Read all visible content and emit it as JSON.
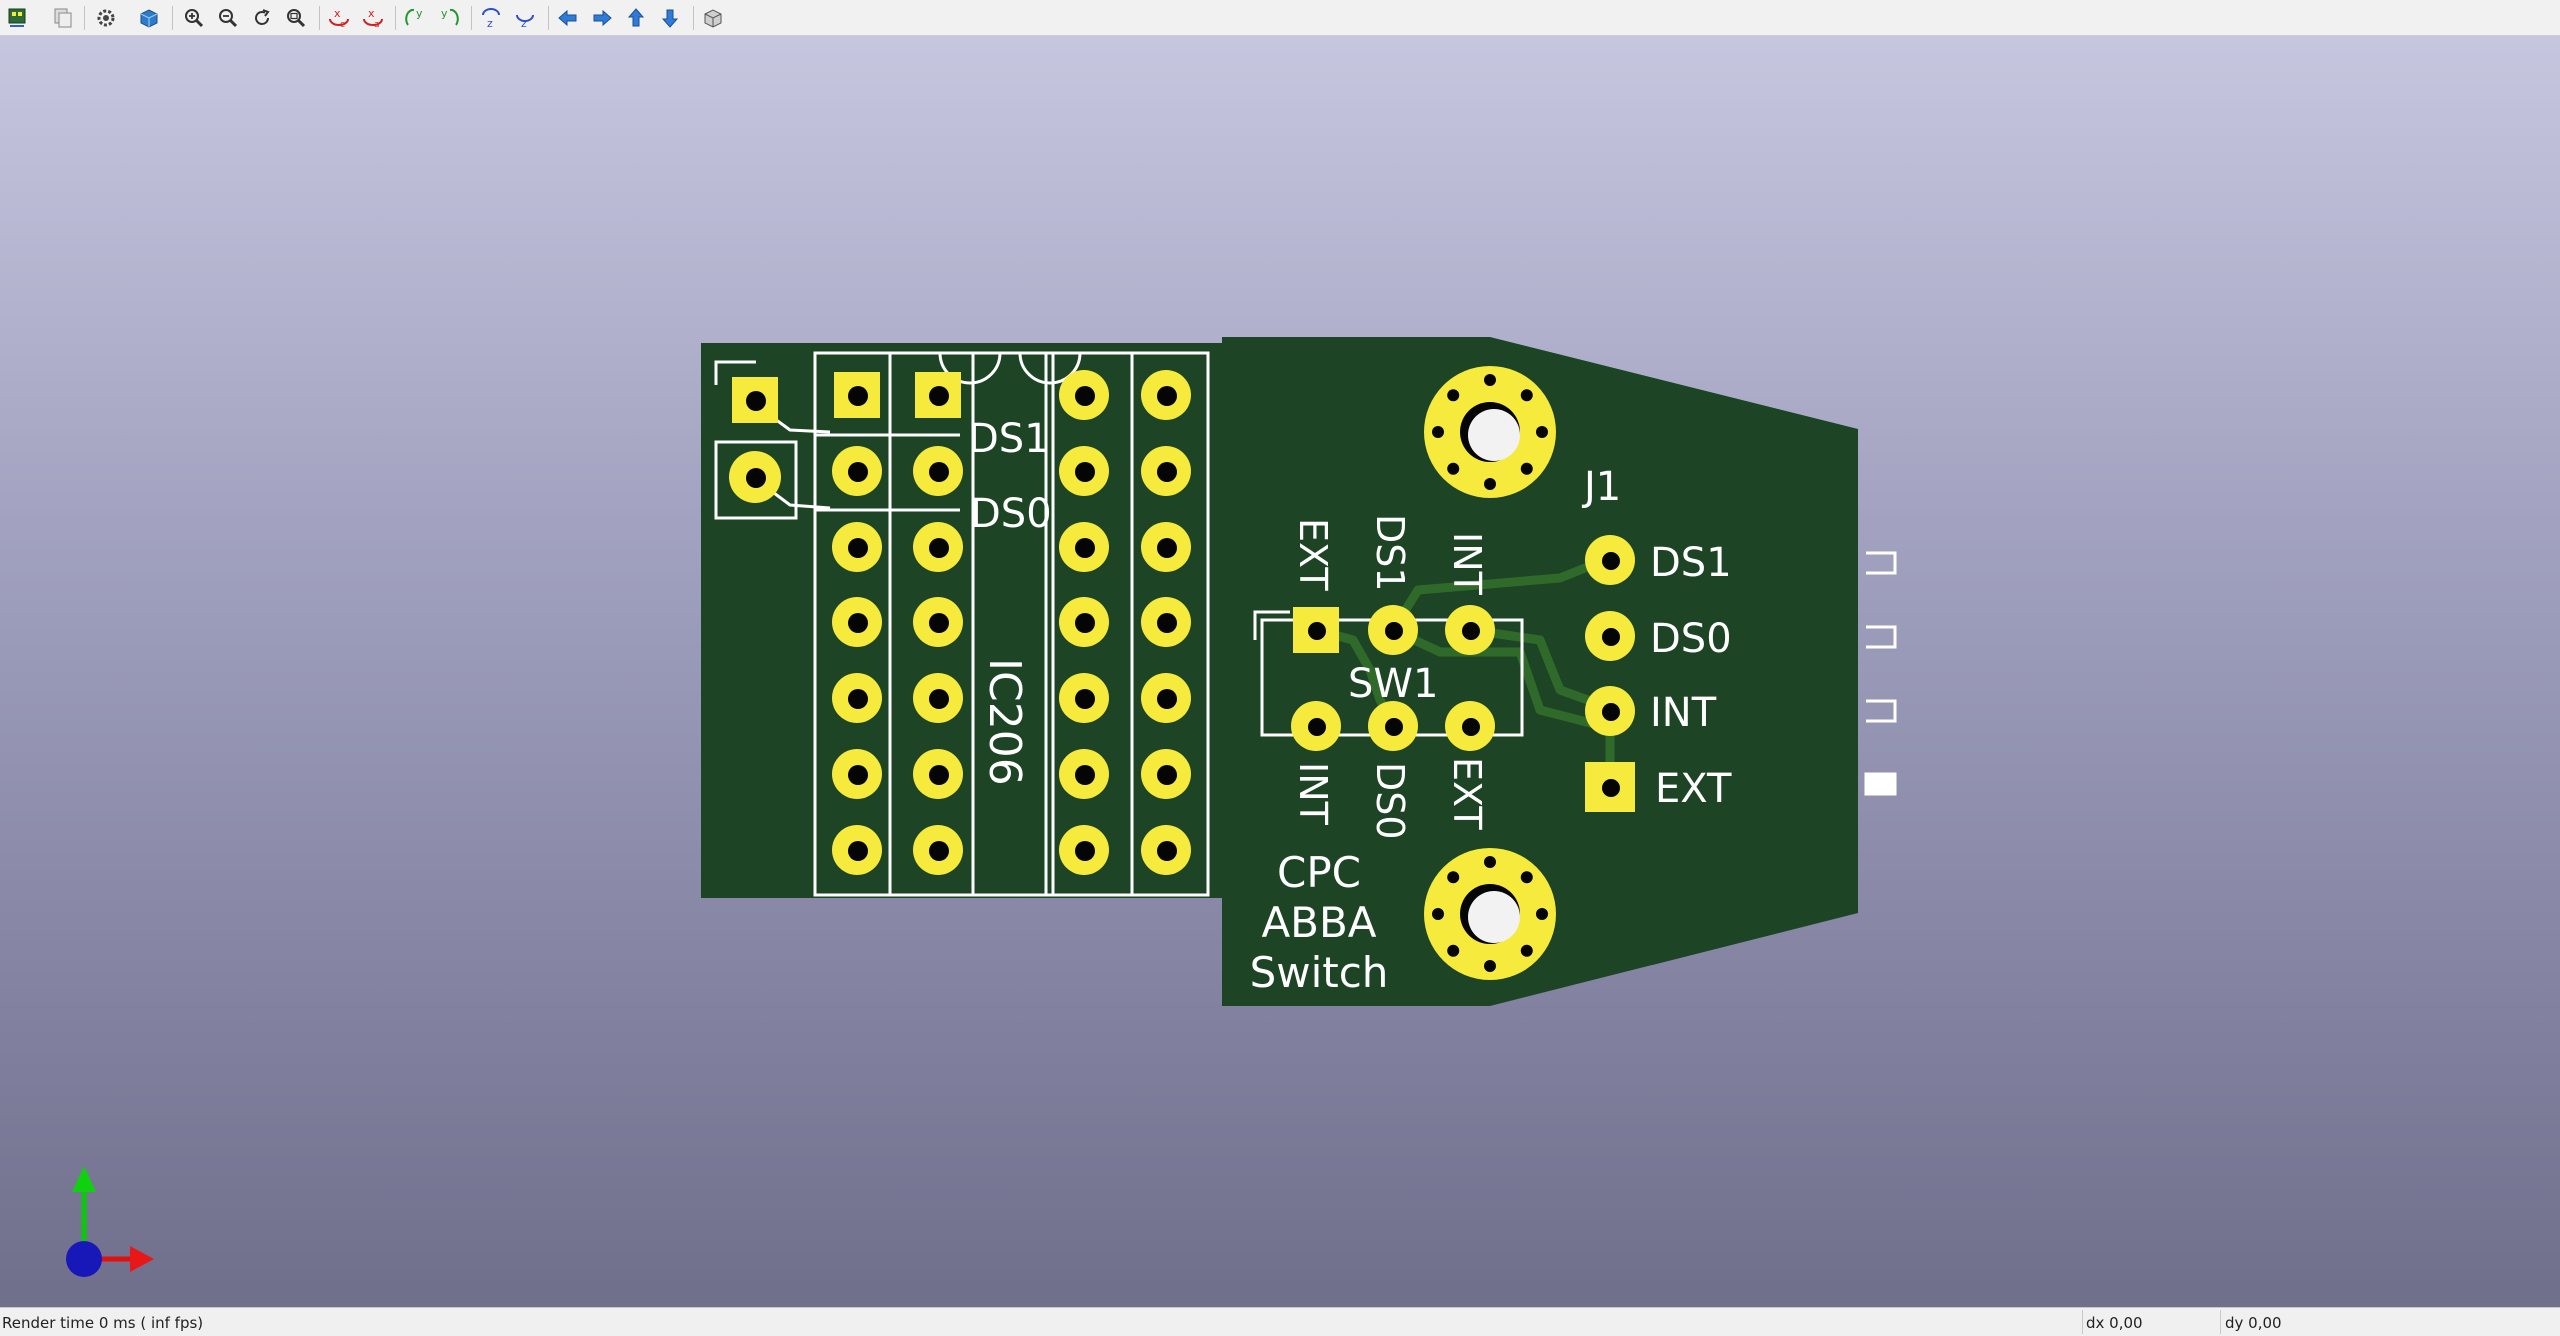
{
  "toolbar": {
    "buttons": [
      {
        "name": "reload-board-icon",
        "title": "Reload board"
      },
      {
        "name": "copy-image-icon",
        "title": "Copy 3D image to clipboard"
      },
      {
        "name": "settings-icon",
        "title": "3D display options"
      },
      {
        "name": "raytracing-icon",
        "title": "Render options"
      },
      {
        "name": "zoom-in-icon",
        "title": "Zoom in"
      },
      {
        "name": "zoom-out-icon",
        "title": "Zoom out"
      },
      {
        "name": "redraw-icon",
        "title": "Redraw"
      },
      {
        "name": "zoom-fit-icon",
        "title": "Zoom to fit"
      },
      {
        "name": "rotate-x-cw-icon",
        "title": "Rotate X clockwise"
      },
      {
        "name": "rotate-x-ccw-icon",
        "title": "Rotate X counterclockwise"
      },
      {
        "name": "rotate-y-cw-icon",
        "title": "Rotate Y clockwise"
      },
      {
        "name": "rotate-y-ccw-icon",
        "title": "Rotate Y counterclockwise"
      },
      {
        "name": "rotate-z-cw-icon",
        "title": "Rotate Z clockwise"
      },
      {
        "name": "rotate-z-ccw-icon",
        "title": "Rotate Z counterclockwise"
      },
      {
        "name": "pan-left-icon",
        "title": "Pan left"
      },
      {
        "name": "pan-right-icon",
        "title": "Pan right"
      },
      {
        "name": "pan-up-icon",
        "title": "Pan up"
      },
      {
        "name": "pan-down-icon",
        "title": "Pan down"
      },
      {
        "name": "orthographic-icon",
        "title": "Toggle orthographic projection"
      }
    ]
  },
  "board": {
    "silkscreen": {
      "ds1_label": "DS1",
      "ds0_label": "DS0",
      "ic_ref": "IC206",
      "connector_ref": "J1",
      "switch_ref": "SW1",
      "conn_pins": [
        "DS1",
        "DS0",
        "INT",
        "EXT"
      ],
      "sw_top": [
        "EXT",
        "DS1",
        "INT"
      ],
      "sw_bottom": [
        "INT",
        "DS0",
        "EXT"
      ],
      "title_lines": [
        "CPC",
        "ABBA",
        "Switch"
      ]
    },
    "colors": {
      "pcb": "#1d4525",
      "copper": "#f6ea3c",
      "silk": "#ffffff",
      "trace": "#2f6a2a",
      "hole": "#050505"
    }
  },
  "status": {
    "render_time": "Render time 0 ms ( inf fps)",
    "dx": "dx 0,00",
    "dy": "dy 0,00"
  }
}
